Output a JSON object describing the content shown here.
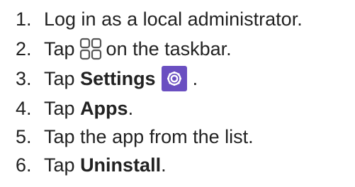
{
  "steps": [
    {
      "number": "1.",
      "parts": {
        "a": "Log in as a local administrator."
      }
    },
    {
      "number": "2.",
      "parts": {
        "a": "Tap",
        "b": "on the taskbar."
      },
      "icon": "apps-grid-icon"
    },
    {
      "number": "3.",
      "parts": {
        "a": "Tap",
        "bold": "Settings",
        "end": "."
      },
      "icon": "settings-gear-icon"
    },
    {
      "number": "4.",
      "parts": {
        "a": "Tap",
        "bold": "Apps",
        "end": "."
      }
    },
    {
      "number": "5.",
      "parts": {
        "a": "Tap the app from the list."
      }
    },
    {
      "number": "6.",
      "parts": {
        "a": "Tap",
        "bold": "Uninstall",
        "end": "."
      }
    }
  ],
  "colors": {
    "text": "#222222",
    "icon_stroke": "#555555",
    "settings_bg": "#6a4fc1"
  }
}
